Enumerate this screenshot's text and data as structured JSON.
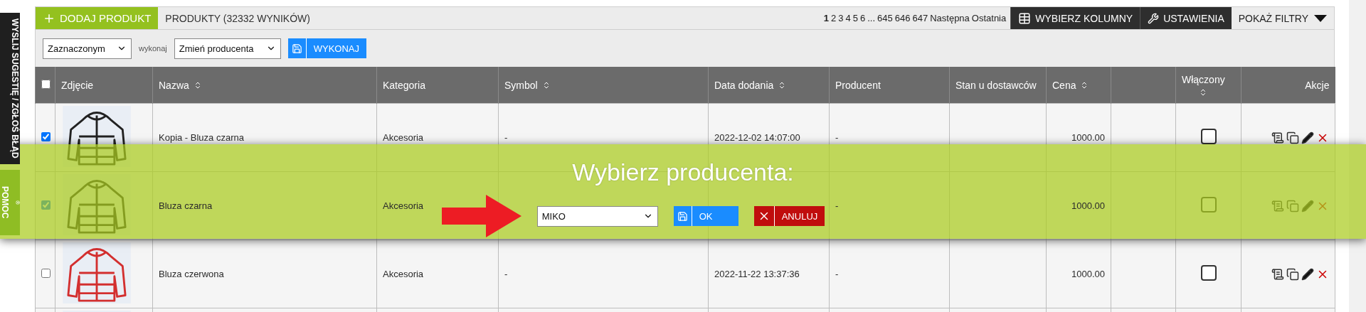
{
  "side_tabs": [
    {
      "kind": "feedback",
      "label": "WYSLIJ SUGESTIĘ / ZGŁOŚ BŁĄD"
    },
    {
      "kind": "help",
      "label": "POMOC"
    }
  ],
  "top_bar": {
    "add_button": "DODAJ PRODUKT",
    "title": "PRODUKTY (32332 WYNIKÓW)",
    "pages": [
      {
        "label": "1",
        "selected": true
      },
      {
        "label": "2",
        "selected": false
      },
      {
        "label": "3",
        "selected": false
      },
      {
        "label": "4",
        "selected": false
      },
      {
        "label": "5",
        "selected": false
      },
      {
        "label": "6",
        "selected": false
      },
      {
        "label": "...",
        "selected": false
      },
      {
        "label": "645",
        "selected": false
      },
      {
        "label": "646",
        "selected": false
      },
      {
        "label": "647",
        "selected": false
      },
      {
        "label": "Następna",
        "selected": false
      },
      {
        "label": "Ostatnia",
        "selected": false
      }
    ],
    "columns_button": "WYBIERZ KOLUMNY",
    "settings_button": "USTAWIENIA",
    "filters_button": "POKAŻ FILTRY"
  },
  "bulk": {
    "scope": "Zaznaczonym",
    "label": "wykonaj",
    "action": "Zmień producenta",
    "button": "WYKONAJ"
  },
  "table": {
    "select_all": false,
    "columns": [
      {
        "label": "Zdjęcie",
        "sortable": false
      },
      {
        "label": "Nazwa",
        "sortable": true
      },
      {
        "label": "Kategoria",
        "sortable": false
      },
      {
        "label": "Symbol",
        "sortable": true
      },
      {
        "label": "Data dodania",
        "sortable": true
      },
      {
        "label": "Producent",
        "sortable": false
      },
      {
        "label": "Stan u dostawców",
        "sortable": false
      },
      {
        "label": "Cena",
        "sortable": true
      },
      {
        "sortable": false
      },
      {
        "label": "Włączony",
        "sortable": true
      },
      {
        "label": "Akcje",
        "sortable": false
      }
    ],
    "rows": [
      {
        "selected": true,
        "image": {
          "kind": "picture"
        },
        "name": "Kopia - Bluza czarna",
        "category": "Akcesoria",
        "symbol": "-",
        "date": "2022-12-02 14:07:00",
        "producer": "-",
        "price": "1000.00",
        "enabled": false
      },
      {
        "selected": true,
        "image": {
          "kind": "picture"
        },
        "name": "Bluza czarna",
        "category": "Akcesoria",
        "producer": "-",
        "price": "1000.00",
        "enabled": false
      },
      {
        "selected": false,
        "image": {
          "kind": "picture"
        },
        "name": "Bluza czerwona",
        "category": "Akcesoria",
        "symbol": "-",
        "date": "2022-11-22 13:37:36",
        "producer": "-",
        "price": "1000.00",
        "enabled": false
      },
      {
        "image": {
          "kind": "picture"
        }
      }
    ]
  },
  "dialog": {
    "title": "Wybierz producenta:",
    "producer": "MIKO",
    "ok": "OK",
    "cancel": "ANULUJ"
  }
}
